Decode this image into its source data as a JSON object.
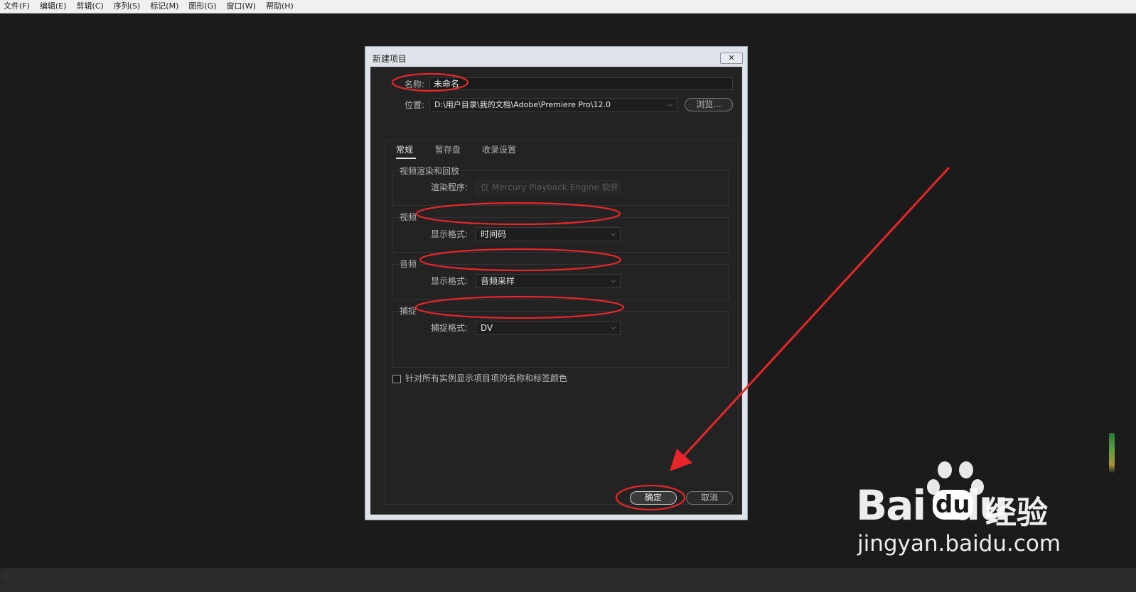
{
  "menubar": {
    "items": [
      "文件(F)",
      "编辑(E)",
      "剪辑(C)",
      "序列(S)",
      "标记(M)",
      "图形(G)",
      "窗口(W)",
      "帮助(H)"
    ]
  },
  "dialog": {
    "title": "新建项目",
    "close_glyph": "✕",
    "name_label": "名称:",
    "name_value": "未命名",
    "location_label": "位置:",
    "location_value": "D:\\用户目录\\我的文档\\Adobe\\Premiere Pro\\12.0",
    "browse_label": "浏览...",
    "tabs": [
      {
        "label": "常规",
        "active": true
      },
      {
        "label": "暂存盘",
        "active": false
      },
      {
        "label": "收录设置",
        "active": false
      }
    ],
    "render_group": {
      "title": "视频渲染和回放",
      "renderer_label": "渲染程序:",
      "renderer_value": "仅 Mercury Playback Engine 软件"
    },
    "video_group": {
      "title": "视频",
      "format_label": "显示格式:",
      "format_value": "时间码"
    },
    "audio_group": {
      "title": "音频",
      "format_label": "显示格式:",
      "format_value": "音频采样"
    },
    "capture_group": {
      "title": "捕捉",
      "format_label": "捕捉格式:",
      "format_value": "DV"
    },
    "checkbox_label": "针对所有实例显示项目项的名称和标签颜色",
    "checkbox_checked": false,
    "ok_label": "确定",
    "cancel_label": "取消"
  },
  "watermark": {
    "brand": "Bai  du",
    "paw_text": "du",
    "suffix": "经验",
    "url": "jingyan.baidu.com"
  },
  "colors": {
    "annotation_red": "#e8262a",
    "dialog_bg": "#232323",
    "workspace_bg": "#1b1b1b"
  }
}
